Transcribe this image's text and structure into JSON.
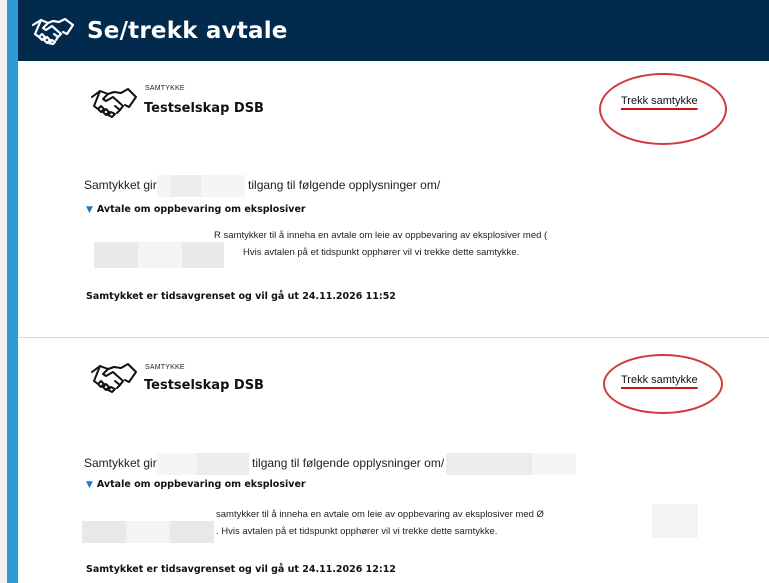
{
  "header": {
    "title": "Se/trekk avtale",
    "icon": "handshake-icon"
  },
  "colors": {
    "header_bg": "#022a4d",
    "accent": "#2e9bd7",
    "highlight_ring": "#cf3a3a",
    "link_underline": "#c21818"
  },
  "consents": [
    {
      "type_label": "SAMTYKKE",
      "company": "Testselskap DSB",
      "withdraw_label": "Trekk samtykke",
      "gives_prefix": "Samtykket gir ",
      "gives_middle": "tilgang til følgende opplysninger om ",
      "agreement_title": "Avtale om oppbevaring om eksplosiver",
      "desc_line1": "R samtykker til å inneha en avtale om leie av oppbevaring av eksplosiver med (",
      "desc_line2": "Hvis avtalen på et tidspunkt opphører vil vi trekke dette samtykke.",
      "expiry": "Samtykket er tidsavgrenset og vil gå ut 24.11.2026 11:52"
    },
    {
      "type_label": "SAMTYKKE",
      "company": "Testselskap DSB",
      "withdraw_label": "Trekk samtykke",
      "gives_prefix": "Samtykket gir ",
      "gives_middle": "tilgang til følgende opplysninger om ",
      "agreement_title": "Avtale om oppbevaring om eksplosiver",
      "desc_line1": "samtykker til å inneha en avtale om leie av oppbevaring av eksplosiver med Ø",
      "desc_line2": ". Hvis avtalen på et tidspunkt opphører vil vi trekke dette samtykke.",
      "expiry": "Samtykket er tidsavgrenset og vil gå ut 24.11.2026 12:12"
    }
  ]
}
